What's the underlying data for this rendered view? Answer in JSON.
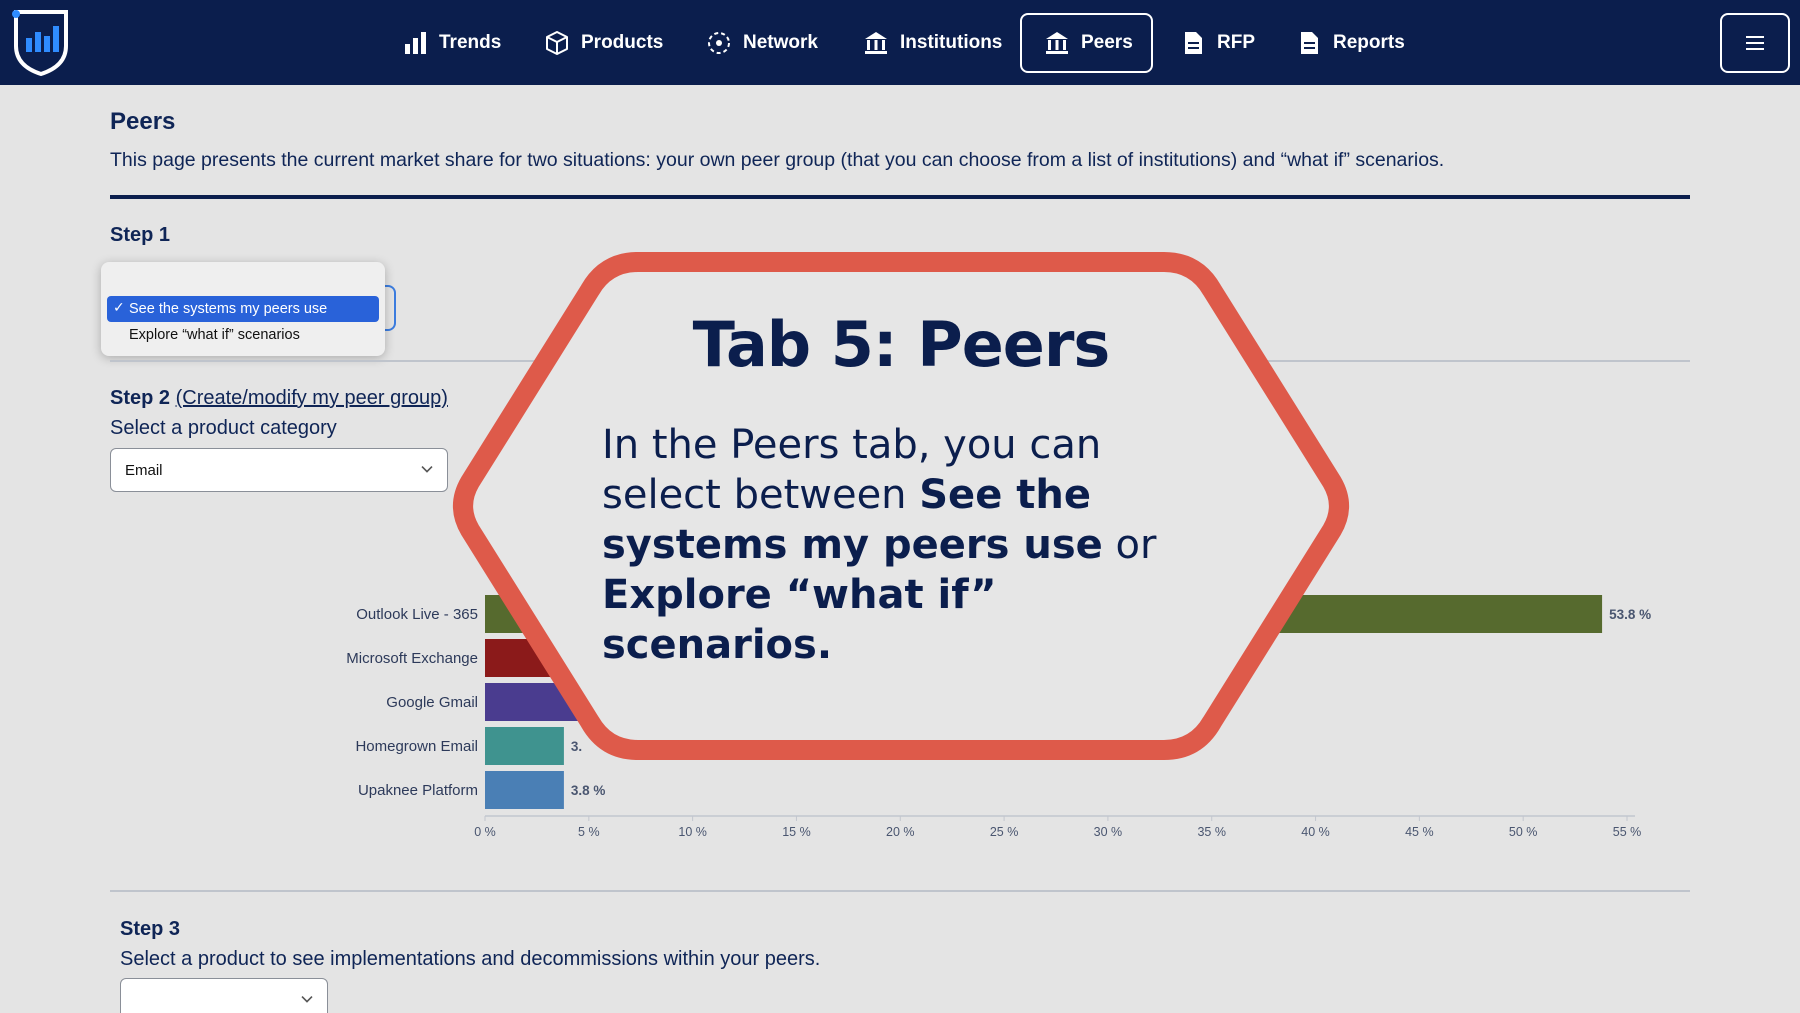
{
  "nav": {
    "items": [
      {
        "label": "Trends",
        "icon": "bar-chart-icon"
      },
      {
        "label": "Products",
        "icon": "cube-icon"
      },
      {
        "label": "Network",
        "icon": "network-icon"
      },
      {
        "label": "Institutions",
        "icon": "bank-icon"
      },
      {
        "label": "Peers",
        "icon": "bank-icon",
        "active": true
      },
      {
        "label": "RFP",
        "icon": "document-icon"
      },
      {
        "label": "Reports",
        "icon": "document-icon"
      }
    ],
    "menu_icon": "hamburger-icon"
  },
  "page": {
    "title": "Peers",
    "description": "This page presents the current market share for two situations: your own peer group (that you can choose from a list of institutions) and “what if” scenarios."
  },
  "step1": {
    "label": "Step 1",
    "options": [
      "See the systems my peers use",
      "Explore “what if” scenarios"
    ],
    "selected": "See the systems my peers use"
  },
  "step2": {
    "label": "Step 2",
    "link": "(Create/modify my peer group)",
    "sub": "Select a product category",
    "select_value": "Email"
  },
  "step3": {
    "label": "Step 3",
    "sub": "Select a product to see implementations and decommissions within your peers.",
    "select_value": ""
  },
  "chart_data": {
    "type": "bar",
    "orientation": "horizontal",
    "categories": [
      "Outlook Live - 365",
      "Microsoft Exchange",
      "Google Gmail",
      "Homegrown Email",
      "Upaknee Platform"
    ],
    "values": [
      53.8,
      null,
      null,
      3.8,
      3.8
    ],
    "value_labels": [
      "53.8 %",
      "",
      "",
      "3.",
      "3.8 %"
    ],
    "colors": [
      "#566a2e",
      "#8b1a1a",
      "#4a3c8f",
      "#3f938f",
      "#4a7fb5"
    ],
    "xlim": [
      0,
      55
    ],
    "xticks": [
      "0 %",
      "5 %",
      "10 %",
      "15 %",
      "20 %",
      "25 %",
      "30 %",
      "35 %",
      "40 %",
      "45 %",
      "50 %",
      "55 %"
    ],
    "grid": false
  },
  "overlay": {
    "title": "Tab 5: Peers",
    "body_1": "In the Peers tab, you can select between ",
    "body_bold_1": "See the systems my peers use",
    "body_2": " or ",
    "body_bold_2": "Explore “what if” scenarios.",
    "border_color": "#de5a4a"
  },
  "colors": {
    "nav_bg": "#0b1e4d",
    "page_bg": "#e4e4e4",
    "selection": "#2962d9"
  }
}
